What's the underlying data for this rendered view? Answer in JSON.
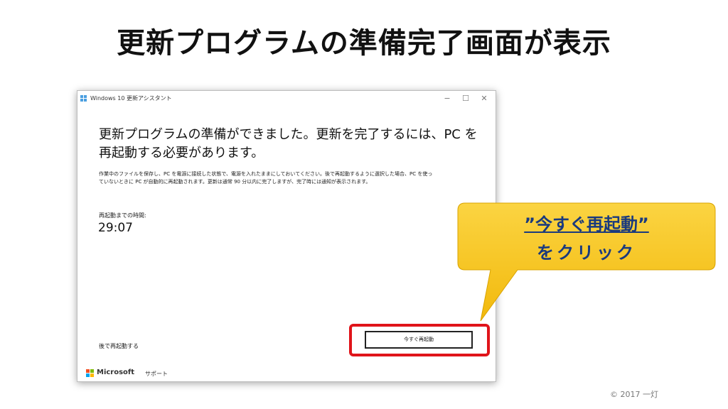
{
  "slide": {
    "title": "更新プログラムの準備完了画面が表示",
    "copyright": "© 2017 一灯"
  },
  "window": {
    "title": "Windows 10 更新アシスタント",
    "controls": {
      "minimize": "−",
      "maximize": "☐",
      "close": "✕"
    },
    "headline_line1": "更新プログラムの準備ができました。更新を完了するには、PC を",
    "headline_line2": "再起動する必要があります。",
    "description_line1": "作業中のファイルを保存し、PC を電源に接続した状態で、電源を入れたままにしておいてください。後で再起動するように選択した場合、PC を使っ",
    "description_line2": "ていないときに PC が自動的に再起動されます。更新は通常 90 分以内に完了しますが、完了時には通知が表示されます。",
    "countdown_label": "再起動までの時間:",
    "countdown_value": "29:07",
    "later_link": "後で再起動する",
    "restart_button": "今すぐ再起動",
    "footer_brand": "Microsoft",
    "footer_support": "サポート"
  },
  "callout": {
    "line1": "”今すぐ再起動”",
    "line2": "をクリック"
  },
  "colors": {
    "highlight": "#e0141a",
    "callout_fill": "#f8c81a",
    "callout_text": "#1a3a7e"
  }
}
